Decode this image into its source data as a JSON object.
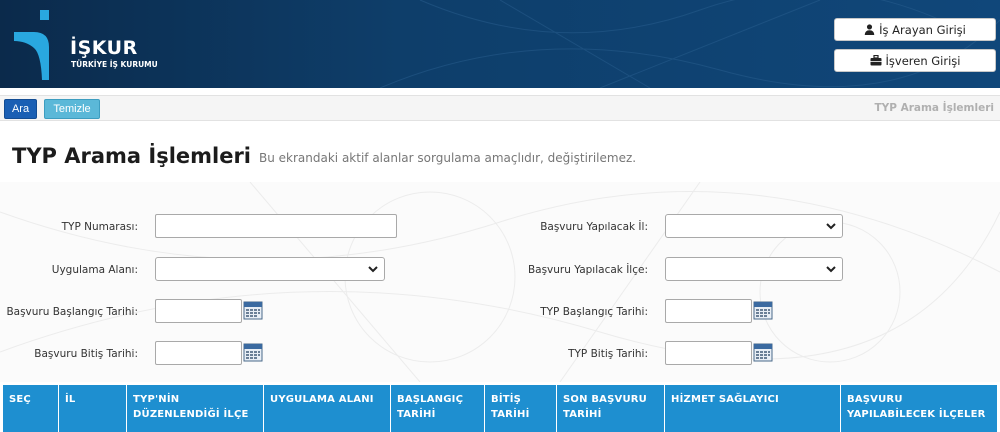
{
  "header": {
    "logo_text": "İŞKUR",
    "logo_subtext": "TÜRKİYE İŞ KURUMU",
    "brand_color": "#10477a",
    "buttons": [
      {
        "label": "İş Arayan Girişi",
        "icon": "user-icon"
      },
      {
        "label": "İşveren Girişi",
        "icon": "briefcase-icon"
      }
    ]
  },
  "toolbar": {
    "search_label": "Ara",
    "clear_label": "Temizle",
    "title": "TYP Arama İşlemleri"
  },
  "page": {
    "title": "TYP Arama İşlemleri",
    "subtitle": "Bu ekrandaki aktif alanlar sorgulama amaçlıdır, değiştirilemez."
  },
  "form": {
    "typ_no_label": "TYP Numarası:",
    "typ_no_value": "",
    "application_area_label": "Uygulama Alanı:",
    "application_area_value": "",
    "apply_start_date_label": "Başvuru Başlangıç Tarihi:",
    "apply_start_date_value": "",
    "apply_end_date_label": "Başvuru Bitiş Tarihi:",
    "apply_end_date_value": "",
    "apply_province_label": "Başvuru Yapılacak İl:",
    "apply_province_value": "",
    "apply_district_label": "Başvuru Yapılacak İlçe:",
    "apply_district_value": "",
    "typ_start_date_label": "TYP Başlangıç Tarihi:",
    "typ_start_date_value": "",
    "typ_end_date_label": "TYP Bitiş Tarihi:",
    "typ_end_date_value": ""
  },
  "table": {
    "header_color": "#1e8fd0",
    "columns": [
      "SEÇ",
      "İL",
      "TYP'NİN DÜZENLENDİĞİ İLÇE",
      "UYGULAMA ALANI",
      "BAŞLANGIÇ TARİHİ",
      "BİTİŞ TARİHİ",
      "SON BAŞVURU TARİHİ",
      "HİZMET SAĞLAYICI",
      "BAŞVURU YAPILABİLECEK İLÇELER"
    ]
  }
}
